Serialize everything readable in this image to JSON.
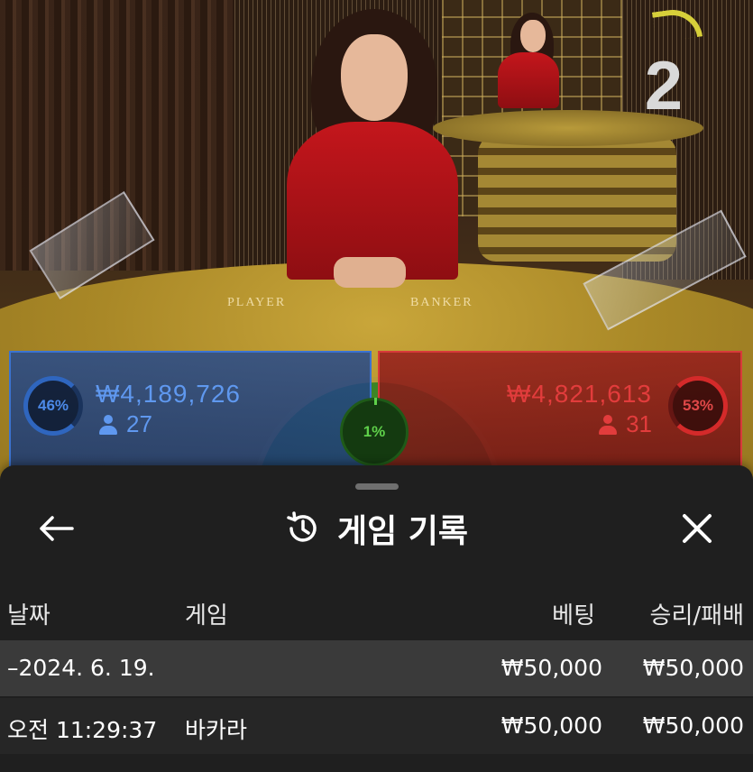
{
  "table": {
    "round_number": "2",
    "player_label": "PLAYER",
    "banker_label": "BANKER"
  },
  "bets": {
    "player": {
      "percent": "46%",
      "amount": "₩4,189,726",
      "players": "27",
      "color": "#3b73d1"
    },
    "tie": {
      "percent": "1%",
      "color": "#4a9a2e"
    },
    "banker": {
      "percent": "53%",
      "amount": "₩4,821,613",
      "players": "31",
      "color": "#d83a3a"
    }
  },
  "history": {
    "title": "게임 기록",
    "title_icon": "history-icon",
    "back_icon": "arrow-left-icon",
    "close_icon": "close-icon",
    "columns": {
      "date": "날짜",
      "game": "게임",
      "bet": "베팅",
      "win_loss": "승리/패배"
    },
    "date_group": {
      "date": "–2024. 6. 19.",
      "bet": "₩50,000",
      "win_loss": "₩50,000"
    },
    "rows": [
      {
        "time": "오전 11:29:37",
        "game": "바카라",
        "bet": "₩50,000",
        "win_loss": "₩50,000"
      }
    ]
  }
}
